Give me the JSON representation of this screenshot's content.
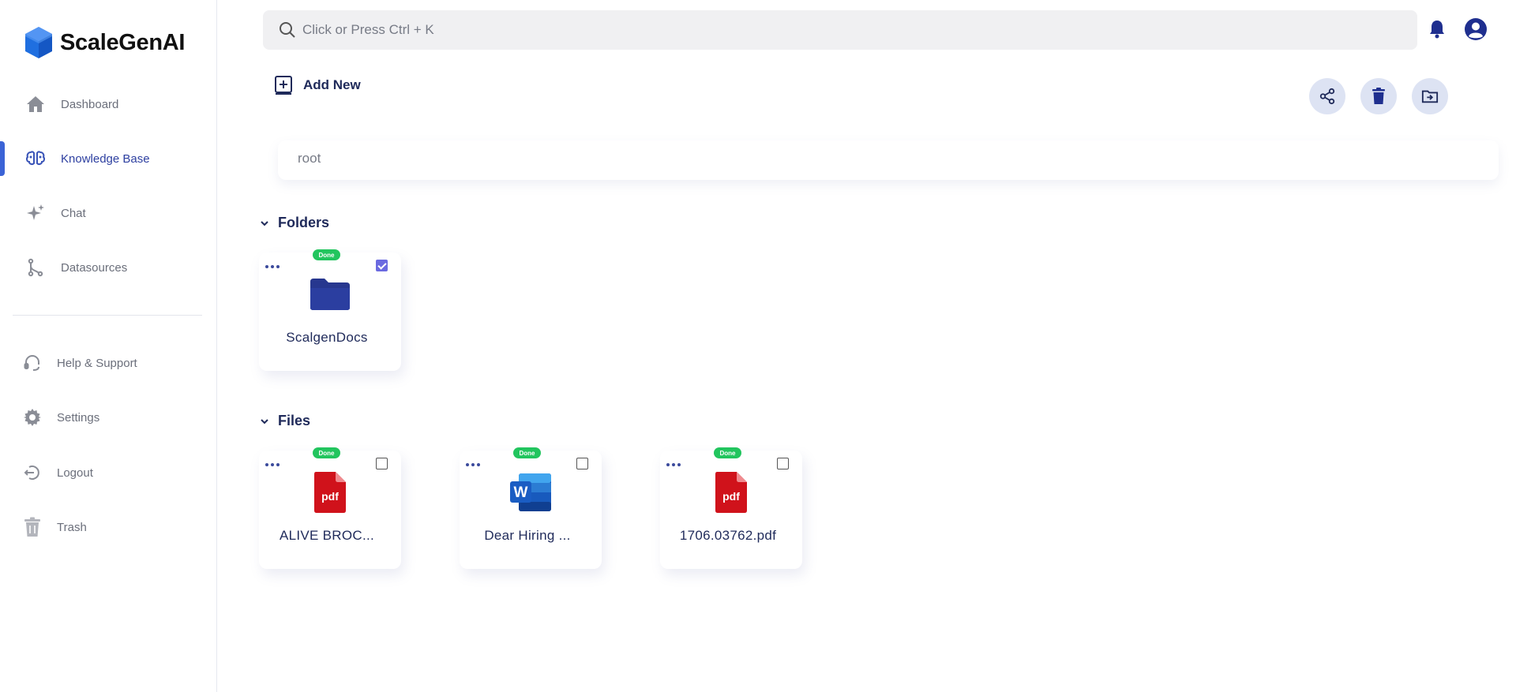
{
  "app": {
    "name": "ScaleGenAI"
  },
  "sidebar": {
    "items": [
      {
        "label": "Dashboard",
        "icon": "home-icon"
      },
      {
        "label": "Knowledge Base",
        "icon": "brain-icon",
        "active": true
      },
      {
        "label": "Chat",
        "icon": "sparkles-icon"
      },
      {
        "label": "Datasources",
        "icon": "branch-icon"
      }
    ],
    "lower_items": [
      {
        "label": "Help & Support",
        "icon": "headset-icon"
      },
      {
        "label": "Settings",
        "icon": "gear-icon"
      },
      {
        "label": "Logout",
        "icon": "logout-icon"
      },
      {
        "label": "Trash",
        "icon": "trash-icon"
      }
    ]
  },
  "search": {
    "placeholder": "Click or Press Ctrl + K"
  },
  "toolbar": {
    "add_new_label": "Add New"
  },
  "breadcrumb": {
    "path": "root"
  },
  "folders": {
    "title": "Folders",
    "items": [
      {
        "name": "ScalgenDocs",
        "status": "Done",
        "checked": true,
        "icon": "folder-icon"
      }
    ]
  },
  "files": {
    "title": "Files",
    "items": [
      {
        "name": "ALIVE BROC...",
        "status": "Done",
        "checked": false,
        "icon": "pdf-icon",
        "icon_text": "pdf"
      },
      {
        "name": "Dear Hiring ...",
        "status": "Done",
        "checked": false,
        "icon": "word-icon",
        "icon_text": "W"
      },
      {
        "name": "1706.03762.pdf",
        "status": "Done",
        "checked": false,
        "icon": "pdf-icon",
        "icon_text": "pdf"
      }
    ]
  },
  "colors": {
    "accent": "#3b63d6",
    "navy": "#1f2a5a",
    "done_badge": "#22c55e",
    "pdf_red": "#d0121b"
  }
}
